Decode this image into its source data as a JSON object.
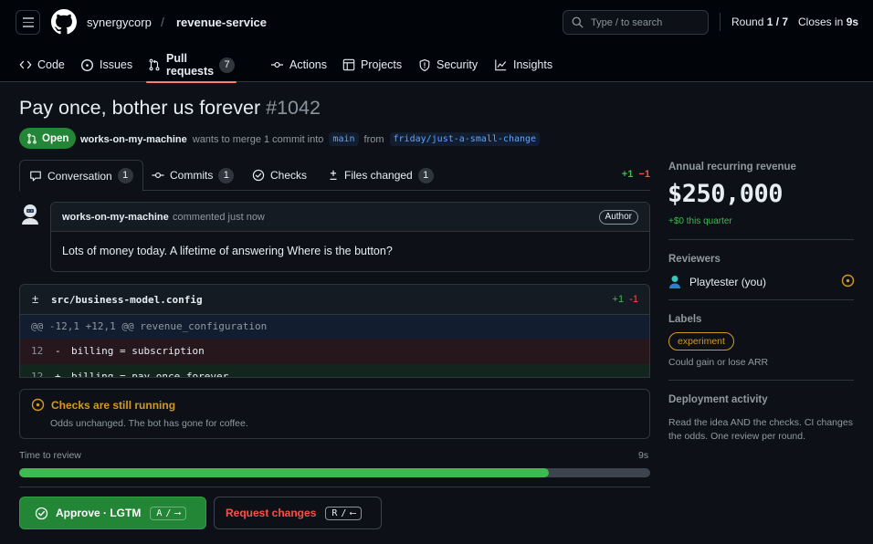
{
  "header": {
    "org": "synergycorp",
    "separator": "/",
    "repo": "revenue-service",
    "search_placeholder": "Type / to search",
    "round_label": "Round",
    "round_value": "1 / 7",
    "closes_label": "Closes in",
    "closes_value": "9s"
  },
  "nav": {
    "items": [
      {
        "label": "Code",
        "icon": "code-icon"
      },
      {
        "label": "Issues",
        "icon": "issue-icon"
      },
      {
        "label": "Pull requests",
        "icon": "pull-request-icon",
        "count": "7",
        "active": true
      },
      {
        "label": "Actions",
        "icon": "commit-icon"
      },
      {
        "label": "Projects",
        "icon": "table-icon"
      },
      {
        "label": "Security",
        "icon": "shield-icon"
      },
      {
        "label": "Insights",
        "icon": "graph-icon"
      }
    ]
  },
  "pr": {
    "title": "Pay once, bother us forever",
    "number": "#1042",
    "state": "Open",
    "author": "works-on-my-machine",
    "merge_text": "wants to merge 1 commit into",
    "base_branch": "main",
    "from_text": "from",
    "head_branch": "friday/just-a-small-change"
  },
  "tabs": [
    {
      "label": "Conversation",
      "count": "1",
      "icon": "comment-icon",
      "active": true
    },
    {
      "label": "Commits",
      "count": "1",
      "icon": "commit-icon"
    },
    {
      "label": "Checks",
      "icon": "check-circle-icon"
    },
    {
      "label": "Files changed",
      "count": "1",
      "icon": "diff-icon"
    }
  ],
  "diffstat": {
    "additions": "+1",
    "deletions": "−1"
  },
  "comment": {
    "author": "works-on-my-machine",
    "time": "commented just now",
    "badge": "Author",
    "body": "Lots of money today. A lifetime of answering Where is the button?"
  },
  "diff": {
    "icon": "±",
    "file": "src/business-model.config",
    "additions": "+1",
    "deletions": "-1",
    "hunk": "@@ -12,1 +12,1 @@ revenue_configuration",
    "lines": [
      {
        "ln": "12",
        "sign": "-",
        "code": "billing = subscription"
      },
      {
        "ln": "12",
        "sign": "+",
        "code": "billing = pay_once_forever"
      }
    ]
  },
  "checks": {
    "title": "Checks are still running",
    "subtitle": "Odds unchanged. The bot has gone for coffee."
  },
  "timer": {
    "label": "Time to review",
    "value": "9s",
    "progress": 0.84
  },
  "actions": {
    "approve_label": "Approve · LGTM",
    "approve_key": "A",
    "approve_arrow": "⟶",
    "request_label": "Request changes",
    "request_key": "R",
    "request_arrow": "⟵"
  },
  "sidebar": {
    "arr_label": "Annual recurring revenue",
    "arr_value": "$250,000",
    "arr_delta": "+$0 this quarter",
    "reviewers_label": "Reviewers",
    "reviewer_name": "Playtester (you)",
    "labels_label": "Labels",
    "label_pill": "experiment",
    "label_note": "Could gain or lose ARR",
    "deploy_label": "Deployment activity",
    "deploy_note": "Read the idea AND the checks. CI changes the odds. One review per round."
  },
  "colors": {
    "background": "#0d1117",
    "header": "#010409",
    "border": "#30363d",
    "accent_green": "#238636",
    "add_green": "#3fb950",
    "delete_red": "#f85149",
    "warning_amber": "#d29922",
    "link_blue": "#58a6ff",
    "tab_underline": "#f78166"
  }
}
